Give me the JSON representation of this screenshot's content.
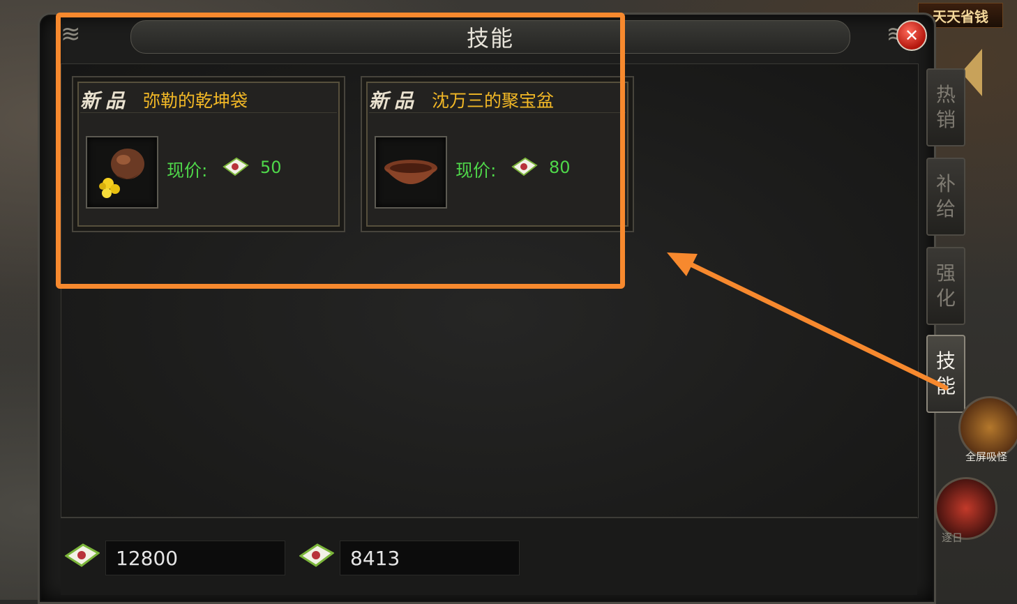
{
  "banner": {
    "text": "天天省钱"
  },
  "panel": {
    "title": "技能"
  },
  "cards": [
    {
      "tag": "新品",
      "name": "弥勒的乾坤袋",
      "price_label": "现价:",
      "price": "50",
      "icon": "coin-bag-icon"
    },
    {
      "tag": "新品",
      "name": "沈万三的聚宝盆",
      "price_label": "现价:",
      "price": "80",
      "icon": "treasure-bowl-icon"
    }
  ],
  "currency": [
    {
      "icon": "ingot-icon",
      "value": "12800"
    },
    {
      "icon": "ingot-icon",
      "value": "8413"
    }
  ],
  "side_tabs": [
    {
      "label_top": "热",
      "label_bottom": "销",
      "active": false
    },
    {
      "label_top": "补",
      "label_bottom": "给",
      "active": false
    },
    {
      "label_top": "强",
      "label_bottom": "化",
      "active": false
    },
    {
      "label_top": "技",
      "label_bottom": "能",
      "active": true
    }
  ],
  "orbs": [
    {
      "label": "全屏吸怪"
    },
    {
      "label": "逐日"
    }
  ],
  "colors": {
    "annotation": "#f7892e",
    "price_green": "#4fd84a",
    "item_name_gold": "#f2b826"
  }
}
